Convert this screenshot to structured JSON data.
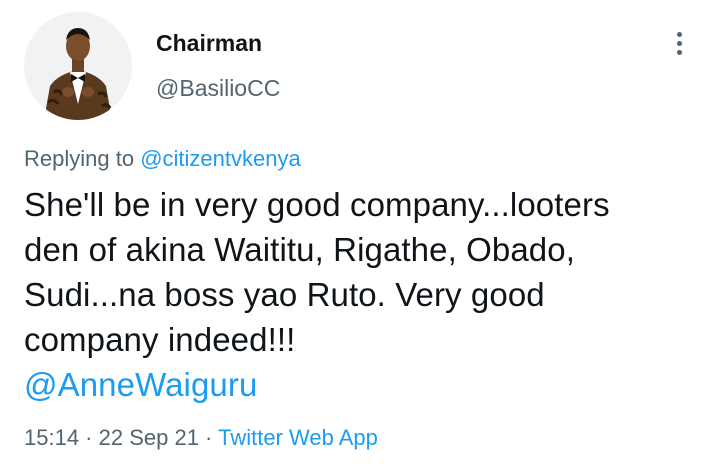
{
  "author": {
    "display_name": "Chairman",
    "handle": "@BasilioCC",
    "avatar_icon": "profile-photo"
  },
  "reply": {
    "prefix": "Replying to ",
    "mention": "@citizentvkenya"
  },
  "tweet": {
    "lines": [
      "She'll be in very good company...looters",
      "den of akina Waititu, Rigathe, Obado,",
      "Sudi...na boss yao Ruto. Very good",
      "company indeed!!!"
    ],
    "mention": "@AnneWaiguru"
  },
  "meta": {
    "time": "15:14",
    "separator_1": " · ",
    "date": "22 Sep 21",
    "separator_2": " · ",
    "source": "Twitter Web App"
  },
  "colors": {
    "link": "#1d9bf0",
    "secondary_text": "#536471",
    "primary_text": "#0f1419"
  }
}
